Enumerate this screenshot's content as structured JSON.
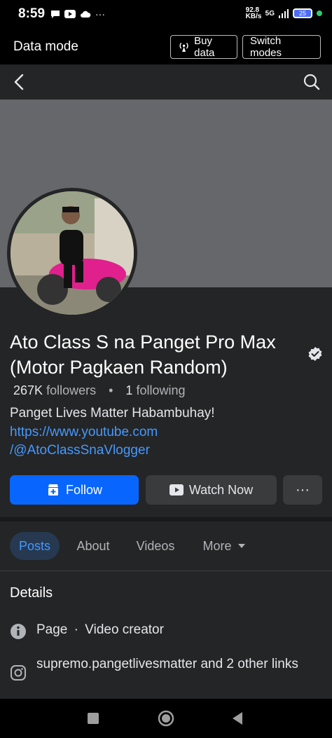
{
  "status_bar": {
    "time": "8:59",
    "net_speed": "92.8 KB/s",
    "network": "5G",
    "battery": "25"
  },
  "data_mode": {
    "title": "Data mode",
    "buy_label": "Buy data",
    "switch_label": "Switch modes"
  },
  "profile": {
    "name": "Ato Class S na Panget Pro Max (Motor Pagkaen Random)",
    "followers_count": "267K",
    "followers_label": "followers",
    "separator": "•",
    "following_count": "1",
    "following_label": "following",
    "bio": "Panget Lives Matter Habambuhay!",
    "link_line1": "https://www.youtube.com",
    "link_line2": "/@AtoClassSnaVlogger"
  },
  "actions": {
    "follow_label": "Follow",
    "watch_label": "Watch Now",
    "more_label": "···"
  },
  "tabs": [
    {
      "label": "Posts"
    },
    {
      "label": "About"
    },
    {
      "label": "Videos"
    },
    {
      "label": "More"
    }
  ],
  "details": {
    "title": "Details",
    "page_type": "Page",
    "page_sep": "·",
    "page_category": "Video creator",
    "links_text": "supremo.pangetlivesmatter and 2 other links"
  },
  "colors": {
    "accent": "#0866ff",
    "link": "#4599ff",
    "background": "#242526"
  }
}
